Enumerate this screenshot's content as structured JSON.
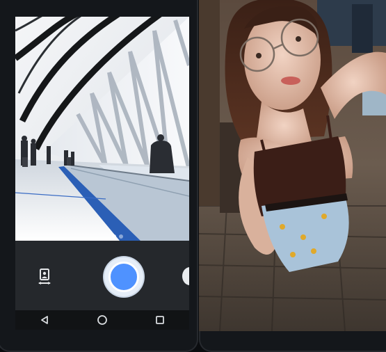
{
  "viewfinder": {
    "scene": "airport-walkway-photo",
    "pager": {
      "count": 2,
      "active": 0
    }
  },
  "camera_controls": {
    "mode_switch_icon": "photo-mode-switch-icon",
    "shutter_icon": "shutter-icon",
    "switch_camera_icon": "switch-camera-icon",
    "accent": "#4f92ff"
  },
  "nav_bar": {
    "back_icon": "back-triangle-icon",
    "home_icon": "home-circle-icon",
    "recents_icon": "recents-square-icon"
  },
  "photo_right": {
    "scene": "selfie-portrait-photo"
  }
}
